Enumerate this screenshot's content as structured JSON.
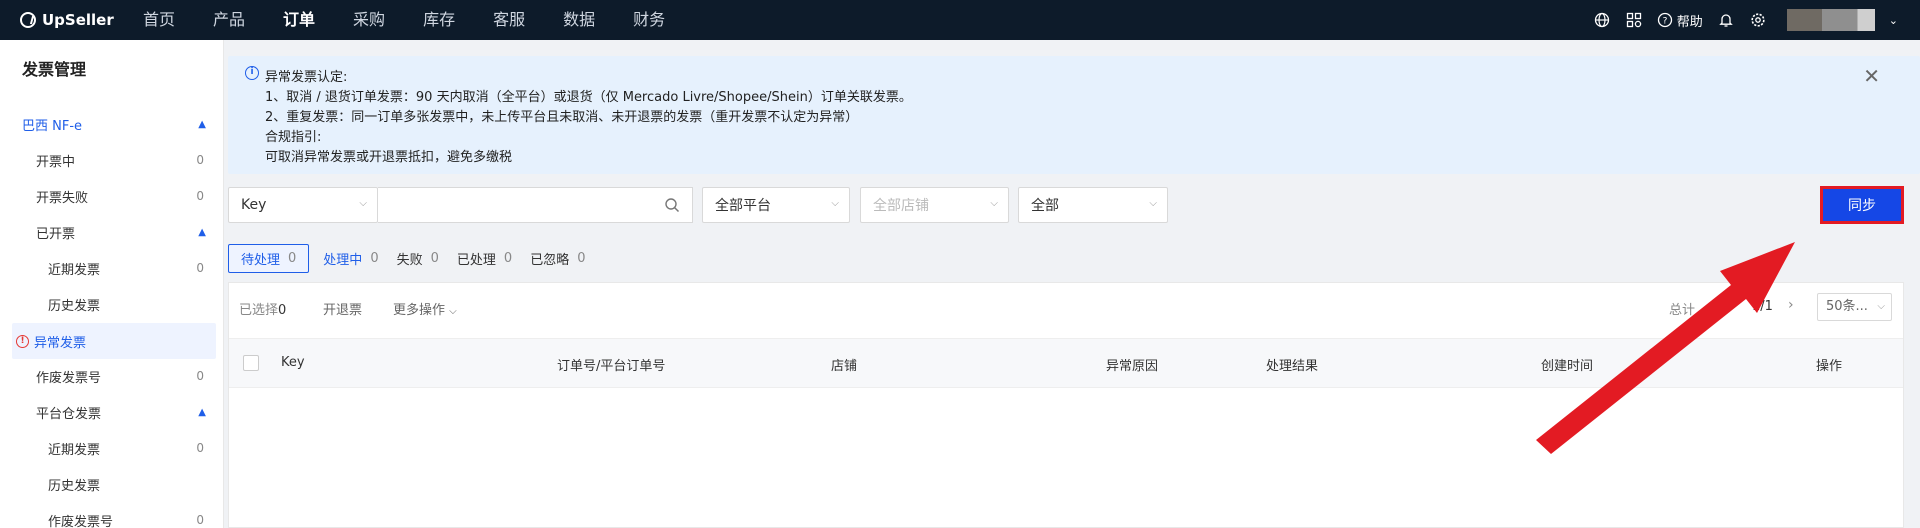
{
  "topbar": {
    "brand": "UpSeller",
    "nav": [
      "首页",
      "产品",
      "订单",
      "采购",
      "库存",
      "客服",
      "数据",
      "财务"
    ],
    "active_nav": "订单",
    "help_label": "帮助"
  },
  "sidebar": {
    "title": "发票管理",
    "items": [
      {
        "label": "巴西 NF-e",
        "count": ""
      },
      {
        "label": "开票中",
        "count": "0"
      },
      {
        "label": "开票失败",
        "count": "0"
      },
      {
        "label": "已开票",
        "count": ""
      },
      {
        "label": "近期发票",
        "count": "0"
      },
      {
        "label": "历史发票",
        "count": ""
      },
      {
        "label": "异常发票",
        "count": ""
      },
      {
        "label": "作废发票号",
        "count": "0"
      },
      {
        "label": "平台仓发票",
        "count": ""
      },
      {
        "label": "近期发票",
        "count": "0"
      },
      {
        "label": "历史发票",
        "count": ""
      },
      {
        "label": "作废发票号",
        "count": "0"
      }
    ]
  },
  "notice": {
    "title": "异常发票认定:",
    "line1": "1、取消 / 退货订单发票：90 天内取消（全平台）或退货（仅 Mercado Livre/Shopee/Shein）订单关联发票。",
    "line2": "2、重复发票：同一订单多张发票中，未上传平台且未取消、未开退票的发票（重开发票不认定为异常）",
    "guide_title": "合规指引:",
    "guide": "可取消异常发票或开退票抵扣，避免多缴税"
  },
  "filters": {
    "key_select": "Key",
    "search_value": "",
    "platform": "全部平台",
    "store_placeholder": "全部店铺",
    "status": "全部",
    "sync_button": "同步"
  },
  "tabs": [
    {
      "label": "待处理",
      "count": "0"
    },
    {
      "label": "处理中",
      "count": "0"
    },
    {
      "label": "失败",
      "count": "0"
    },
    {
      "label": "已处理",
      "count": "0"
    },
    {
      "label": "已忽略",
      "count": "0"
    }
  ],
  "table": {
    "selected_label": "已选择",
    "selected_count": "0",
    "refund_button": "开退票",
    "more_actions": "更多操作",
    "total_label": "总计",
    "page_indicator": "1/1",
    "page_size": "50条...",
    "columns": [
      "Key",
      "订单号/平台订单号",
      "店铺",
      "异常原因",
      "处理结果",
      "创建时间",
      "操作"
    ],
    "rows": []
  },
  "colors": {
    "nav_bg": "#0d1b2a",
    "accent": "#1f5ee8",
    "sync_btn": "#1547e6",
    "highlight_red": "#e31b23"
  }
}
